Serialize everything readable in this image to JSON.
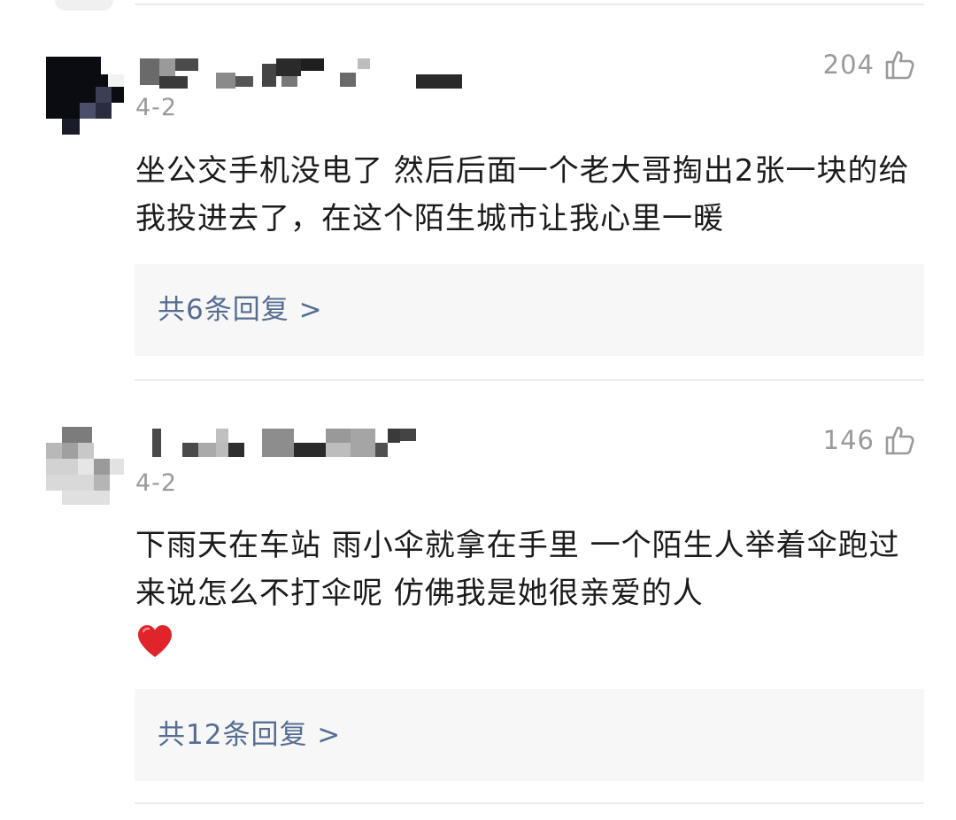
{
  "comments": [
    {
      "date": "4-2",
      "likes": "204",
      "text": "坐公交手机没电了 然后后面一个老大哥掏出2张一块的给我投进去了，在这个陌生城市让我心里一暖",
      "has_heart_emoji": false,
      "replies_label": "共6条回复 >"
    },
    {
      "date": "4-2",
      "likes": "146",
      "text": "下雨天在车站 雨小伞就拿在手里 一个陌生人举着伞跑过来说怎么不打伞呢 仿佛我是她很亲爱的人",
      "has_heart_emoji": true,
      "replies_label": "共12条回复 >"
    }
  ],
  "icons": {
    "like": "thumbs-up-outline-icon",
    "emoji": "red-heart-emoji"
  },
  "colors": {
    "link": "#566d92",
    "meta": "#9a9a9a",
    "text": "#1b1b1b",
    "panel": "#f7f7f7",
    "heart": "#e0242b"
  }
}
